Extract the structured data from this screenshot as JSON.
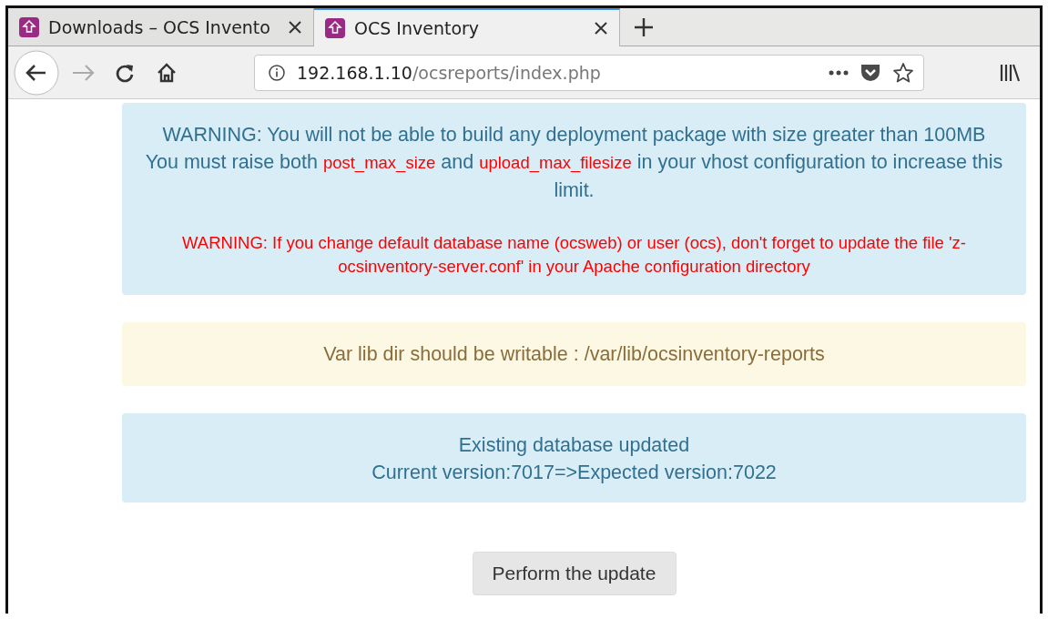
{
  "tabs": [
    {
      "title": "Downloads – OCS Invento",
      "selected": false
    },
    {
      "title": "OCS Inventory",
      "selected": true
    }
  ],
  "address": {
    "host": "192.168.1.10",
    "path": "/ocsreports/index.php"
  },
  "alerts": [
    {
      "kind": "info",
      "paragraphs": [
        {
          "kind": "plain",
          "segments": [
            {
              "kind": "text",
              "text": "WARNING: You will not be able to build any deployment package with size greater than 100MB"
            }
          ]
        },
        {
          "kind": "plain",
          "segments": [
            {
              "kind": "text",
              "text": "You must raise both "
            },
            {
              "kind": "highlight",
              "text": "post_max_size"
            },
            {
              "kind": "text",
              "text": " and "
            },
            {
              "kind": "highlight",
              "text": "upload_max_filesize"
            },
            {
              "kind": "text",
              "text": " in your vhost configuration to increase this limit."
            }
          ]
        },
        {
          "kind": "danger",
          "segments": [
            {
              "kind": "text",
              "text": "WARNING: If you change default database name (ocsweb) or user (ocs), don't forget to update the file 'z-ocsinventory-server.conf' in your Apache configuration directory"
            }
          ]
        }
      ]
    },
    {
      "kind": "warning",
      "paragraphs": [
        {
          "kind": "plain",
          "segments": [
            {
              "kind": "text",
              "text": "Var lib dir should be writable : /var/lib/ocsinventory-reports"
            }
          ]
        }
      ]
    },
    {
      "kind": "info",
      "paragraphs": [
        {
          "kind": "plain",
          "segments": [
            {
              "kind": "text",
              "text": "Existing database updated"
            }
          ]
        },
        {
          "kind": "plain",
          "segments": [
            {
              "kind": "text",
              "text": "Current version:7017=>Expected version:7022"
            }
          ]
        }
      ]
    }
  ],
  "button": {
    "label": "Perform the update"
  }
}
